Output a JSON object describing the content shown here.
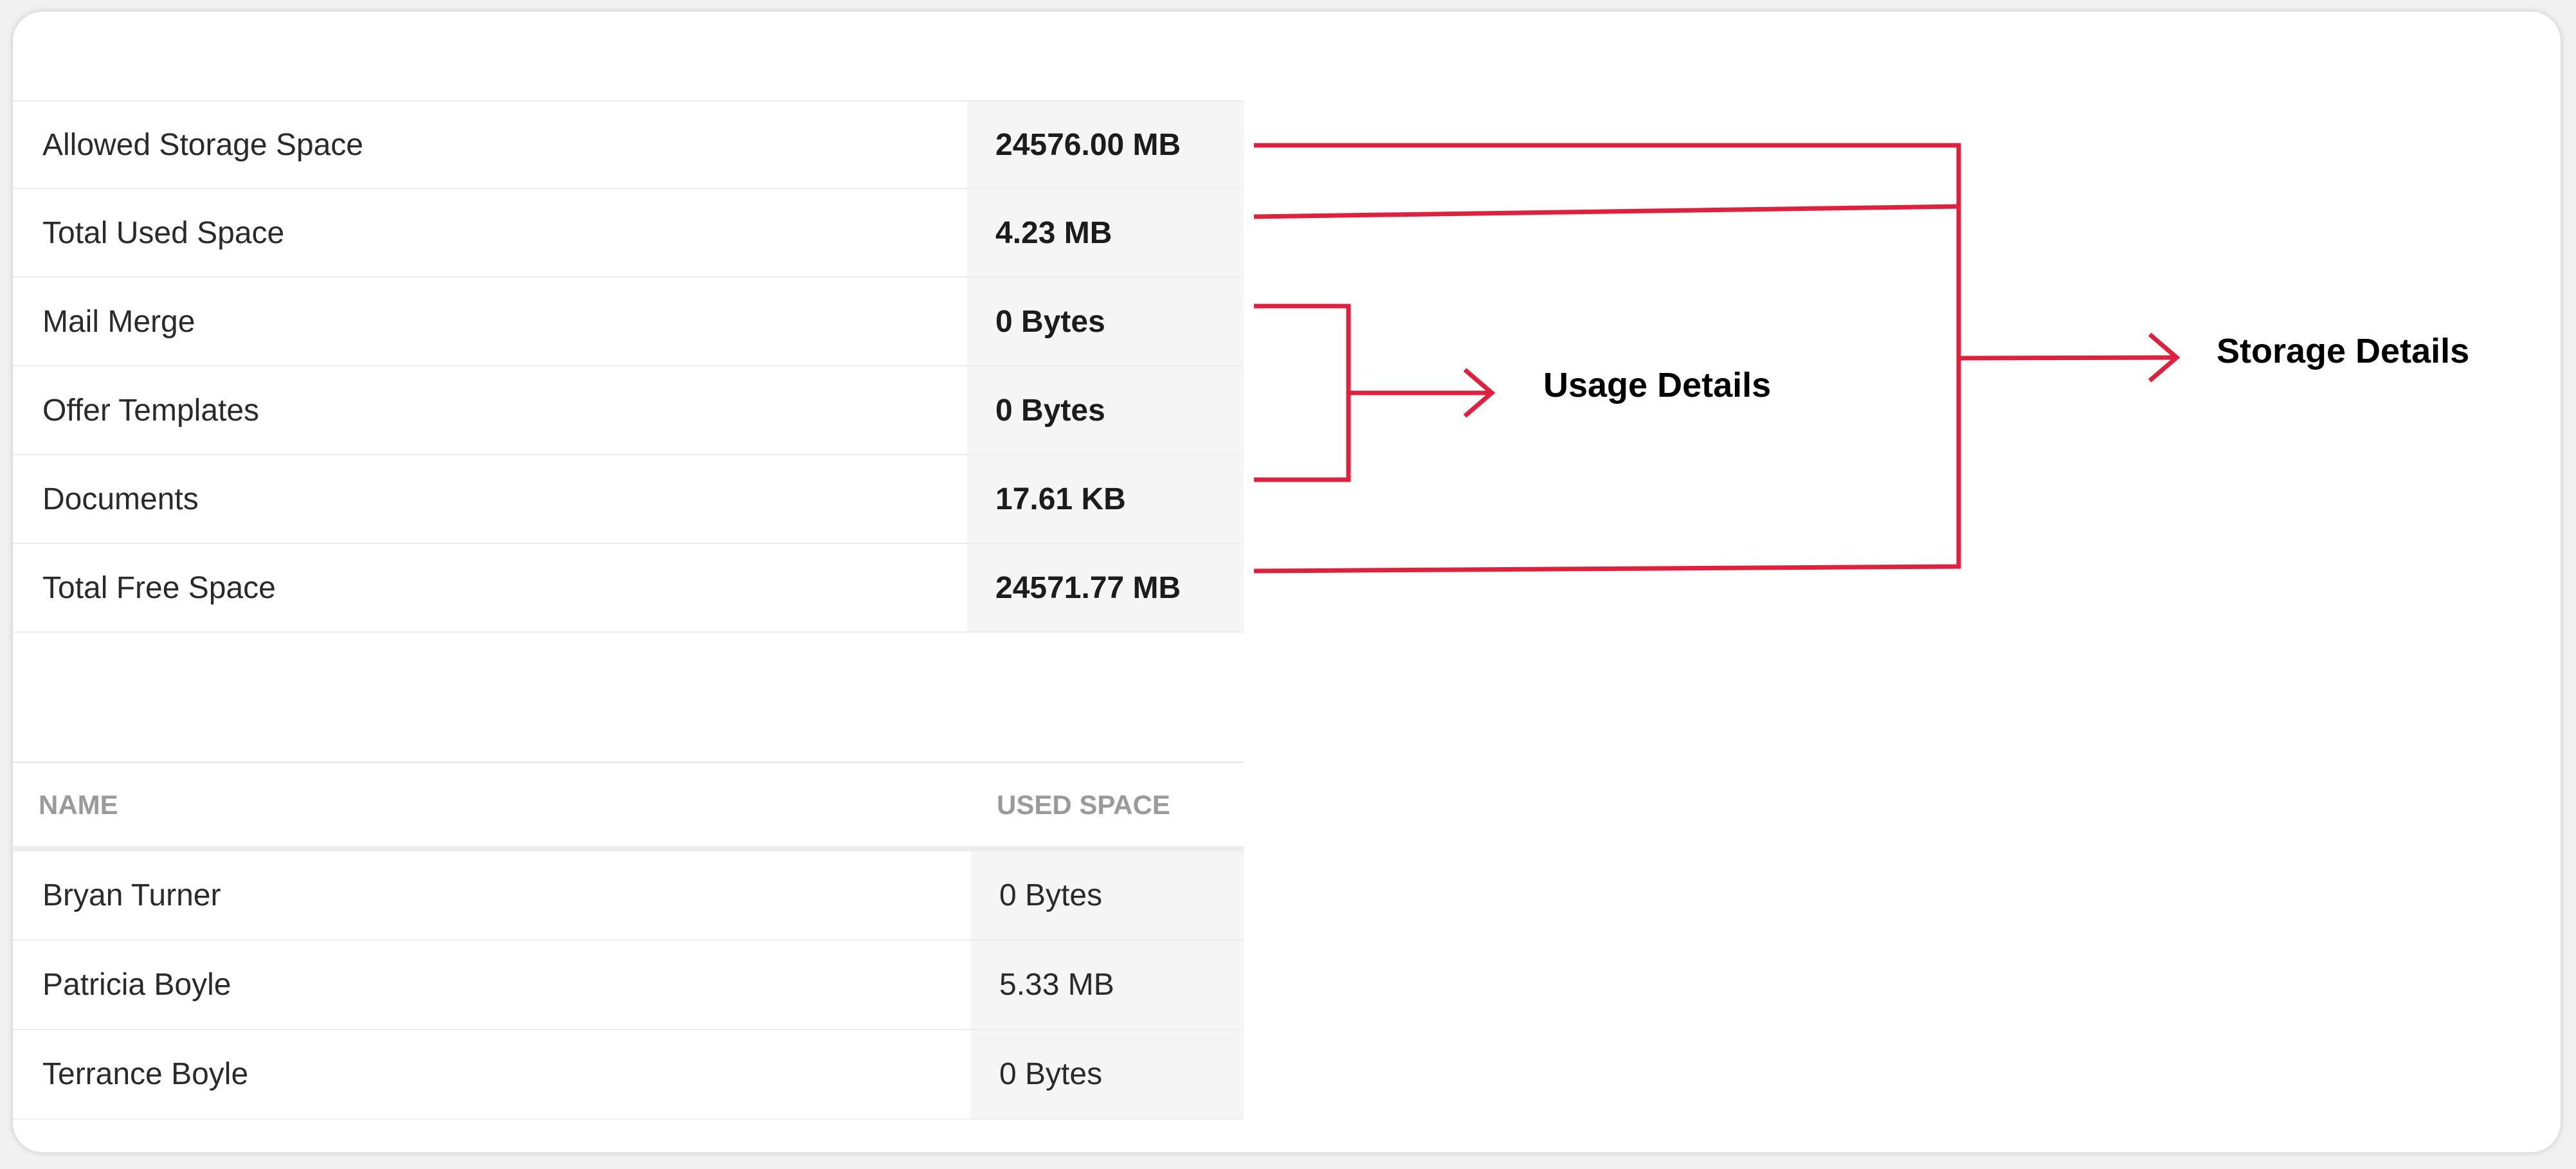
{
  "storage_summary": {
    "rows": [
      {
        "label": "Allowed Storage Space",
        "value": "24576.00 MB"
      },
      {
        "label": "Total Used Space",
        "value": "4.23 MB"
      },
      {
        "label": "Mail Merge",
        "value": "0 Bytes"
      },
      {
        "label": "Offer Templates",
        "value": "0 Bytes"
      },
      {
        "label": "Documents",
        "value": "17.61 KB"
      },
      {
        "label": "Total Free Space",
        "value": "24571.77 MB"
      }
    ]
  },
  "user_usage": {
    "headers": {
      "name": "NAME",
      "used_space": "USED SPACE"
    },
    "rows": [
      {
        "name": "Bryan Turner",
        "used_space": "0 Bytes"
      },
      {
        "name": "Patricia Boyle",
        "used_space": "5.33 MB"
      },
      {
        "name": "Terrance Boyle",
        "used_space": "0 Bytes"
      }
    ]
  },
  "annotations": {
    "usage_details": "Usage Details",
    "storage_details": "Storage Details",
    "connector_color": "#e0203c"
  }
}
